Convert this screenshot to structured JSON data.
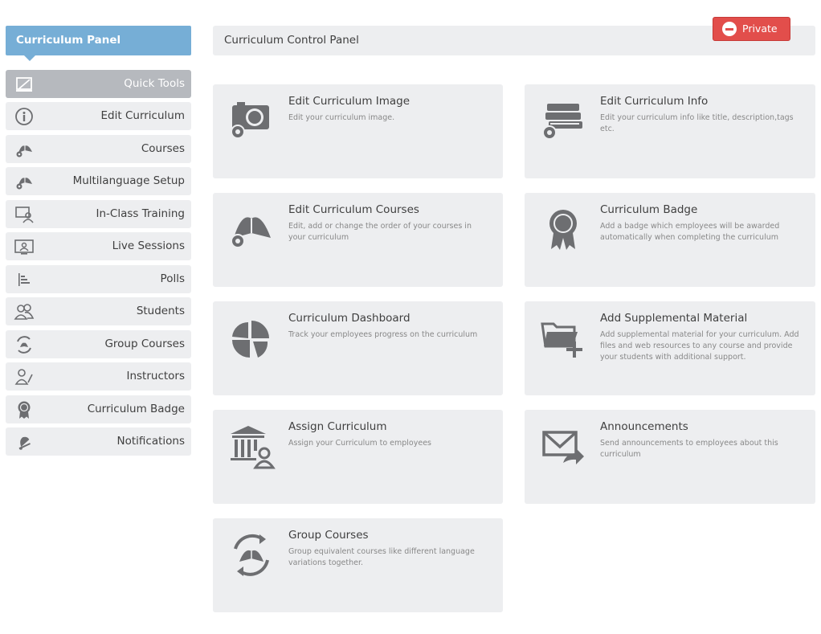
{
  "sidebar": {
    "header": "Curriculum Panel",
    "items": [
      {
        "label": "Quick Tools",
        "icon": "quick-tools-icon"
      },
      {
        "label": "Edit Curriculum",
        "icon": "info-icon"
      },
      {
        "label": "Courses",
        "icon": "book-gear-icon"
      },
      {
        "label": "Multilanguage Setup",
        "icon": "book-gear-icon"
      },
      {
        "label": "In-Class Training",
        "icon": "classroom-icon"
      },
      {
        "label": "Live Sessions",
        "icon": "live-session-icon"
      },
      {
        "label": "Polls",
        "icon": "poll-icon"
      },
      {
        "label": "Students",
        "icon": "students-icon"
      },
      {
        "label": "Group Courses",
        "icon": "group-courses-icon"
      },
      {
        "label": "Instructors",
        "icon": "instructor-icon"
      },
      {
        "label": "Curriculum Badge",
        "icon": "badge-icon"
      },
      {
        "label": "Notifications",
        "icon": "bell-icon"
      }
    ]
  },
  "topbar": {
    "title": "Curriculum Control Panel",
    "private_label": "Private"
  },
  "cards": [
    {
      "title": "Edit Curriculum Image",
      "desc": "Edit your curriculum image.",
      "icon": "camera-gear-icon"
    },
    {
      "title": "Edit Curriculum Info",
      "desc": "Edit your curriculum info like title, description,tags etc.",
      "icon": "books-gear-icon"
    },
    {
      "title": "Edit Curriculum Courses",
      "desc": "Edit, add or change the order of your courses in your curriculum",
      "icon": "open-book-gear-icon"
    },
    {
      "title": "Curriculum Badge",
      "desc": "Add a badge which employees will be awarded automatically when completing the curriculum",
      "icon": "badge-icon"
    },
    {
      "title": "Curriculum Dashboard",
      "desc": "Track your employees progress on the curriculum",
      "icon": "pie-chart-icon"
    },
    {
      "title": "Add Supplemental Material",
      "desc": "Add supplemental material for your curriculum. Add files and web resources to any course and provide your students with additional support.",
      "icon": "folder-add-icon"
    },
    {
      "title": "Assign Curriculum",
      "desc": "Assign your Curriculum to employees",
      "icon": "institution-user-icon"
    },
    {
      "title": "Announcements",
      "desc": "Send announcements to employees about this curriculum",
      "icon": "envelope-share-icon"
    },
    {
      "title": "Group Courses",
      "desc": "Group equivalent courses like different language variations together.",
      "icon": "group-courses-icon"
    }
  ],
  "colors": {
    "panel_header": "#76aed6",
    "private_button": "#e24e4b",
    "card_bg": "#edeef0",
    "icon": "#6d6e71"
  }
}
